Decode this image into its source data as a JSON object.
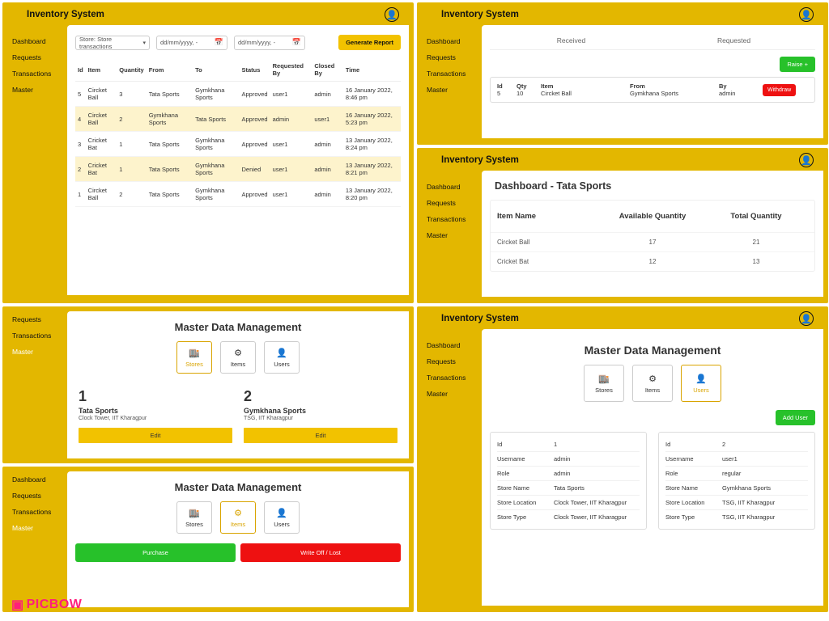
{
  "appTitle": "Inventory System",
  "nav": [
    "Dashboard",
    "Requests",
    "Transactions",
    "Master"
  ],
  "A": {
    "storeSel": "Store: Store transactions",
    "date": "dd/mm/yyyy, -",
    "gen": "Generate Report",
    "cols": [
      "Id",
      "Item",
      "Quantity",
      "From",
      "To",
      "Status",
      "Requested By",
      "Closed By",
      "Time"
    ],
    "rows": [
      {
        "id": "5",
        "item": "Circket Ball",
        "qty": "3",
        "from": "Tata Sports",
        "to": "Gymkhana Sports",
        "status": "Approved",
        "rb": "user1",
        "cb": "admin",
        "time": "16 January 2022, 8:46 pm",
        "hl": false
      },
      {
        "id": "4",
        "item": "Circket Ball",
        "qty": "2",
        "from": "Gymkhana Sports",
        "to": "Tata Sports",
        "status": "Approved",
        "rb": "admin",
        "cb": "user1",
        "time": "16 January 2022, 5:23 pm",
        "hl": true
      },
      {
        "id": "3",
        "item": "Cricket Bat",
        "qty": "1",
        "from": "Tata Sports",
        "to": "Gymkhana Sports",
        "status": "Approved",
        "rb": "user1",
        "cb": "admin",
        "time": "13 January 2022, 8:24 pm",
        "hl": false
      },
      {
        "id": "2",
        "item": "Cricket Bat",
        "qty": "1",
        "from": "Tata Sports",
        "to": "Gymkhana Sports",
        "status": "Denied",
        "rb": "user1",
        "cb": "admin",
        "time": "13 January 2022, 8:21 pm",
        "hl": true
      },
      {
        "id": "1",
        "item": "Circket Ball",
        "qty": "2",
        "from": "Tata Sports",
        "to": "Gymkhana Sports",
        "status": "Approved",
        "rb": "user1",
        "cb": "admin",
        "time": "13 January 2022, 8:20 pm",
        "hl": false
      }
    ]
  },
  "B": {
    "tabs": [
      "Received",
      "Requested"
    ],
    "raise": "Raise  +",
    "cols": [
      "Id",
      "Qty",
      "Item",
      "From",
      "By"
    ],
    "row": {
      "id": "5",
      "qty": "10",
      "item": "Circket Ball",
      "from": "Gymkhana Sports",
      "by": "admin"
    },
    "withdraw": "Withdraw"
  },
  "C": {
    "title": "Dashboard - Tata Sports",
    "cols": [
      "Item Name",
      "Available Quantity",
      "Total Quantity"
    ],
    "rows": [
      [
        "Circket Ball",
        "17",
        "21"
      ],
      [
        "Cricket Bat",
        "12",
        "13"
      ]
    ]
  },
  "D": {
    "title": "Master Data Management",
    "cards": [
      "Stores",
      "Items",
      "Users"
    ],
    "stores": [
      {
        "n": "1",
        "name": "Tata Sports",
        "loc": "Clock Tower, IIT Kharagpur",
        "edit": "Edit"
      },
      {
        "n": "2",
        "name": "Gymkhana Sports",
        "loc": "TSG, IIT Kharagpur",
        "edit": "Edit"
      }
    ]
  },
  "E": {
    "title": "Master Data Management",
    "cards": [
      "Stores",
      "Items",
      "Users"
    ],
    "purchase": "Purchase",
    "wol": "Write Off / Lost"
  },
  "F": {
    "title": "Master Data Management",
    "cards": [
      "Stores",
      "Items",
      "Users"
    ],
    "addUser": "Add User",
    "fields": [
      "Id",
      "Username",
      "Role",
      "Store Name",
      "Store Location",
      "Store Type"
    ],
    "users": [
      {
        "Id": "1",
        "Username": "admin",
        "Role": "admin",
        "Store Name": "Tata Sports",
        "Store Location": "Clock Tower, IIT Kharagpur",
        "Store Type": "Clock Tower, IIT Kharagpur"
      },
      {
        "Id": "2",
        "Username": "user1",
        "Role": "regular",
        "Store Name": "Gymkhana Sports",
        "Store Location": "TSG, IIT Kharagpur",
        "Store Type": "TSG, IIT Kharagpur"
      }
    ]
  },
  "watermark": "PICBOW"
}
